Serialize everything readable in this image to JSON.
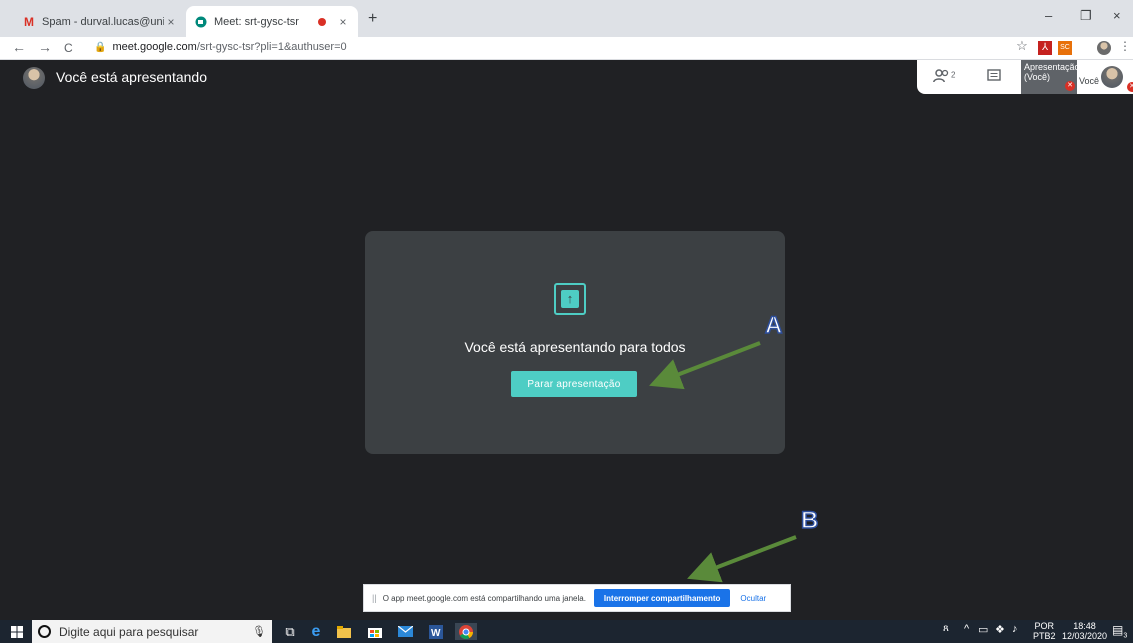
{
  "browser": {
    "tabs": [
      {
        "title": "Spam - durval.lucas@unifesp.br - ",
        "icon": "gmail-icon",
        "close": "×"
      },
      {
        "title": "Meet: srt-gysc-tsr",
        "icon": "meet-icon",
        "close": "×",
        "recording": true
      }
    ],
    "new_tab": "+",
    "window_controls": {
      "minimize": "–",
      "restore": "❐",
      "close": "×"
    },
    "nav": {
      "back": "←",
      "forward": "→",
      "reload": "C"
    },
    "url_host": "meet.google.com",
    "url_path": "/srt-gysc-tsr?pli=1&authuser=0",
    "bookmark_star": "☆",
    "extensions": [
      "SC"
    ],
    "menu": "⋮"
  },
  "meet": {
    "header_title": "Você está apresentando",
    "people_count": "2",
    "tiles": {
      "presentation_label": "Apresentação (Você)",
      "you_label": "Você"
    },
    "card": {
      "message": "Você está apresentando para todos",
      "stop_button": "Parar apresentação"
    },
    "annotations": {
      "a": "A",
      "b": "B"
    }
  },
  "sharebar": {
    "grip": "||",
    "message": "O app meet.google.com está compartilhando uma janela.",
    "interrupt_button": "Interromper compartilhamento",
    "hide_link": "Ocultar"
  },
  "taskbar": {
    "search_placeholder": "Digite aqui para pesquisar",
    "language": "POR",
    "layout": "PTB2",
    "time": "18:48",
    "date": "12/03/2020",
    "notification_count": "3"
  },
  "colors": {
    "meet_background": "#202124",
    "card": "#3c4043",
    "accent_teal": "#4ecdc4",
    "share_blue": "#1a73e8",
    "arrow_green": "#5a8a3a",
    "annotation_letter": "#2d4f9e"
  }
}
